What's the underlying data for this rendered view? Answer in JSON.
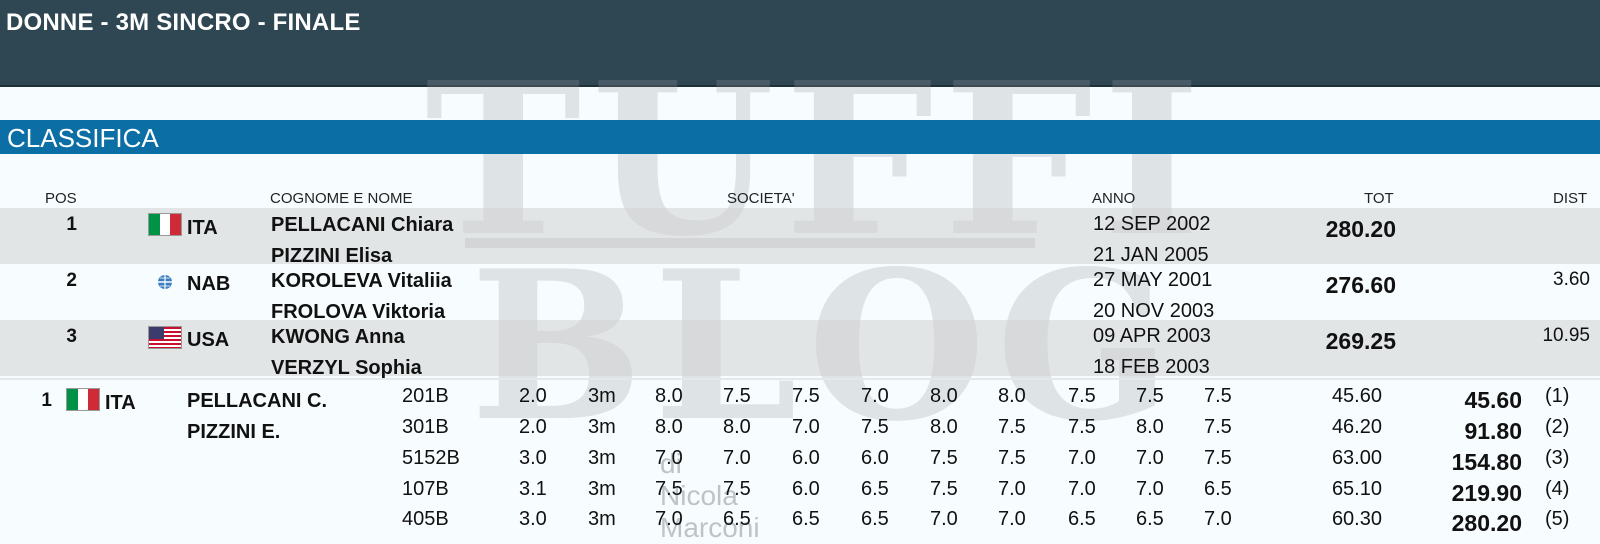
{
  "header": {
    "title": "DONNE - 3M SINCRO - FINALE"
  },
  "section": {
    "title": "CLASSIFICA"
  },
  "watermark": {
    "line1": "TUFFI",
    "line2": "BLOG",
    "byline": "di Nicola Marconi"
  },
  "columns": {
    "pos": "POS",
    "name": "COGNOME E NOME",
    "club": "SOCIETA'",
    "year": "ANNO",
    "tot": "TOT",
    "dist": "DIST"
  },
  "ranking": [
    {
      "pos": "1",
      "nation": "ITA",
      "flag": "ita-flag",
      "athlete1": "PELLACANI Chiara",
      "athlete2": "PIZZINI Elisa",
      "dob1": "12 SEP 2002",
      "dob2": "21 JAN 2005",
      "tot": "280.20",
      "dist": ""
    },
    {
      "pos": "2",
      "nation": "NAB",
      "flag": "nab-flag",
      "athlete1": "KOROLEVA Vitaliia",
      "athlete2": "FROLOVA Viktoria",
      "dob1": "27 MAY 2001",
      "dob2": "20 NOV 2003",
      "tot": "276.60",
      "dist": "3.60"
    },
    {
      "pos": "3",
      "nation": "USA",
      "flag": "usa-flag",
      "athlete1": "KWONG Anna",
      "athlete2": "VERZYL Sophia",
      "dob1": "09 APR 2003",
      "dob2": "18 FEB 2003",
      "tot": "269.25",
      "dist": "10.95"
    }
  ],
  "detail": {
    "pos": "1",
    "nation": "ITA",
    "athlete1": "PELLACANI C.",
    "athlete2": "PIZZINI E.",
    "dives": [
      {
        "code": "201B",
        "dd": "2.0",
        "height": "3m",
        "scores": [
          "8.0",
          "7.5",
          "7.5",
          "7.0",
          "8.0",
          "8.0",
          "7.5",
          "7.5",
          "7.5"
        ],
        "points": "45.60",
        "total": "45.60",
        "round": "(1)"
      },
      {
        "code": "301B",
        "dd": "2.0",
        "height": "3m",
        "scores": [
          "8.0",
          "8.0",
          "7.0",
          "7.5",
          "8.0",
          "7.5",
          "7.5",
          "8.0",
          "7.5"
        ],
        "points": "46.20",
        "total": "91.80",
        "round": "(2)"
      },
      {
        "code": "5152B",
        "dd": "3.0",
        "height": "3m",
        "scores": [
          "7.0",
          "7.0",
          "6.0",
          "6.0",
          "7.5",
          "7.5",
          "7.0",
          "7.0",
          "7.5"
        ],
        "points": "63.00",
        "total": "154.80",
        "round": "(3)"
      },
      {
        "code": "107B",
        "dd": "3.1",
        "height": "3m",
        "scores": [
          "7.5",
          "7.5",
          "6.0",
          "6.5",
          "7.5",
          "7.0",
          "7.0",
          "7.0",
          "6.5"
        ],
        "points": "65.10",
        "total": "219.90",
        "round": "(4)"
      },
      {
        "code": "405B",
        "dd": "3.0",
        "height": "3m",
        "scores": [
          "7.0",
          "6.5",
          "6.5",
          "6.5",
          "7.0",
          "7.0",
          "6.5",
          "6.5",
          "7.0"
        ],
        "points": "60.30",
        "total": "280.20",
        "round": "(5)"
      }
    ]
  }
}
